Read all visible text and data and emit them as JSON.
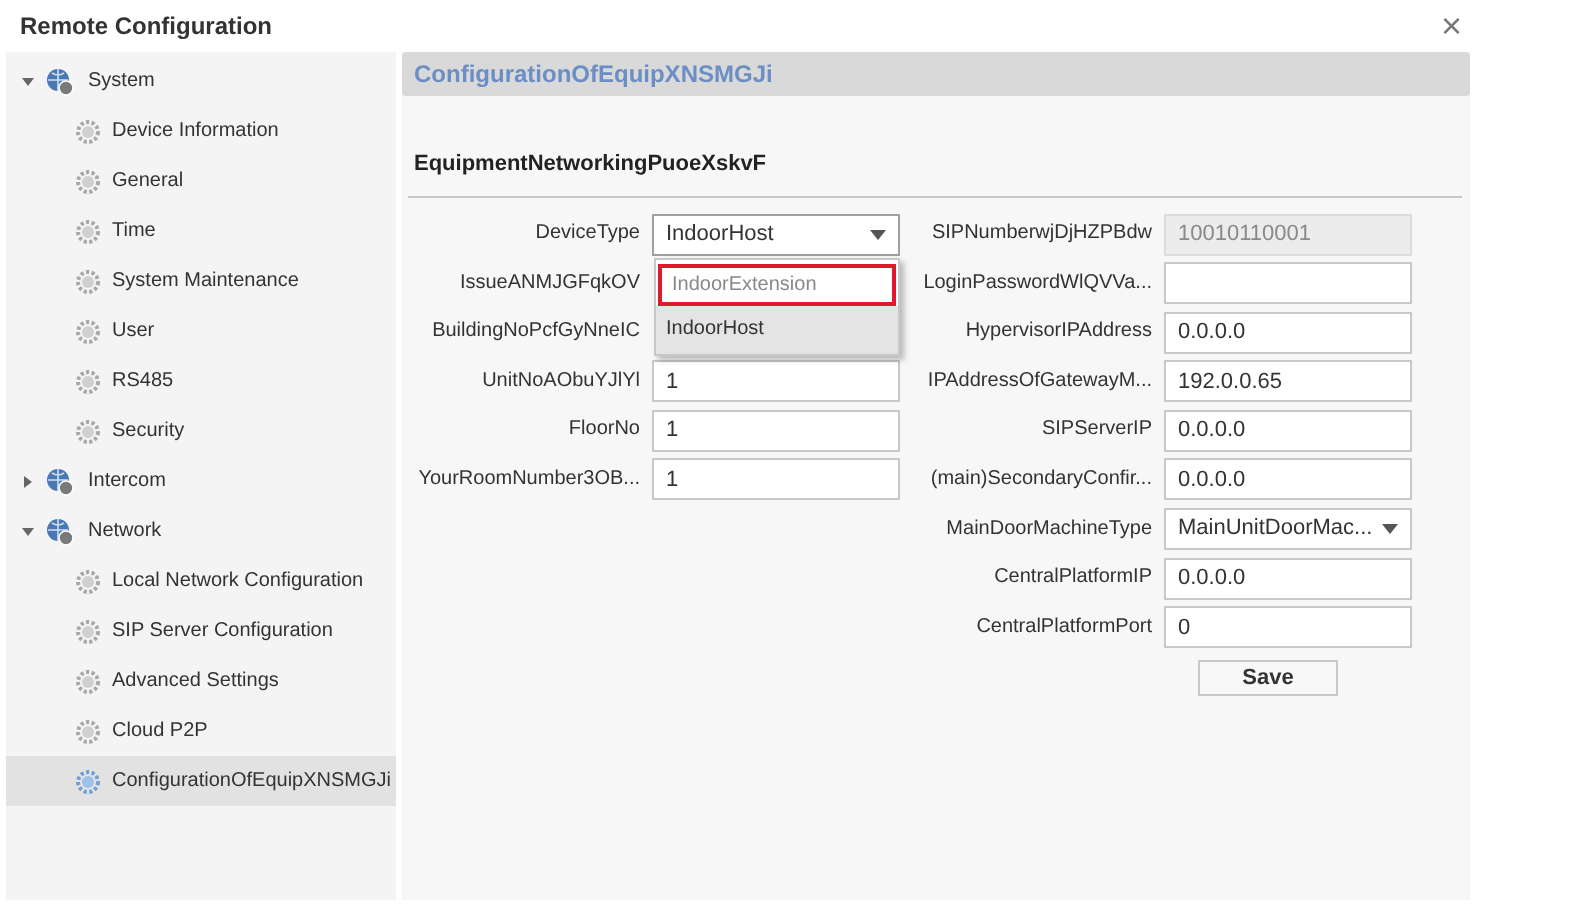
{
  "window": {
    "title": "Remote Configuration",
    "close": "×"
  },
  "sidebar": {
    "items": [
      {
        "label": "System",
        "expanded": true,
        "children": [
          {
            "label": "Device Information",
            "selected": false
          },
          {
            "label": "General",
            "selected": false
          },
          {
            "label": "Time",
            "selected": false
          },
          {
            "label": "System Maintenance",
            "selected": false
          },
          {
            "label": "User",
            "selected": false
          },
          {
            "label": "RS485",
            "selected": false
          },
          {
            "label": "Security",
            "selected": false
          }
        ]
      },
      {
        "label": "Intercom",
        "expanded": false
      },
      {
        "label": "Network",
        "expanded": true,
        "children": [
          {
            "label": "Local Network Configuration",
            "selected": false
          },
          {
            "label": "SIP Server Configuration",
            "selected": false
          },
          {
            "label": "Advanced Settings",
            "selected": false
          },
          {
            "label": "Cloud P2P",
            "selected": false
          },
          {
            "label": "ConfigurationOfEquipXNSMGJi",
            "selected": true
          }
        ]
      }
    ]
  },
  "panel": {
    "title": "ConfigurationOfEquipXNSMGJi",
    "section": "EquipmentNetworkingPuoeXskvF",
    "left_fields": [
      {
        "label": "DeviceType",
        "kind": "select",
        "value": "IndoorHost",
        "open": true,
        "options": [
          {
            "label": "IndoorExtension",
            "selected": false,
            "marked": true
          },
          {
            "label": "IndoorHost",
            "selected": true,
            "marked": false
          }
        ]
      },
      {
        "label": "IssueANMJGFqkOV",
        "kind": "covered"
      },
      {
        "label": "BuildingNoPcfGyNneIC",
        "kind": "covered"
      },
      {
        "label": "UnitNoAObuYJlYl",
        "kind": "text",
        "value": "1"
      },
      {
        "label": "FloorNo",
        "kind": "text",
        "value": "1"
      },
      {
        "label": "YourRoomNumber3OB...",
        "kind": "text",
        "value": "1"
      }
    ],
    "right_fields": [
      {
        "label": "SIPNumberwjDjHZPBdw",
        "kind": "text",
        "value": "10010110001",
        "disabled": true
      },
      {
        "label": "LoginPasswordWlQVVa...",
        "kind": "text",
        "disabled": false
      },
      {
        "label": "HypervisorIPAddress",
        "kind": "text",
        "value": "0.0.0.0",
        "disabled": false
      },
      {
        "label": "IPAddressOfGatewayM...",
        "kind": "text",
        "value": "192.0.0.65",
        "disabled": false
      },
      {
        "label": "SIPServerIP",
        "kind": "text",
        "value": "0.0.0.0",
        "disabled": false
      },
      {
        "label": "(main)SecondaryConfir...",
        "kind": "text",
        "value": "0.0.0.0",
        "disabled": false
      },
      {
        "label": "MainDoorMachineType",
        "kind": "select",
        "value": "MainUnitDoorMac...",
        "open": false
      },
      {
        "label": "CentralPlatformIP",
        "kind": "text",
        "value": "0.0.0.0",
        "disabled": false
      },
      {
        "label": "CentralPlatformPort",
        "kind": "text",
        "value": "0",
        "disabled": false
      }
    ],
    "save_button": "Save"
  }
}
